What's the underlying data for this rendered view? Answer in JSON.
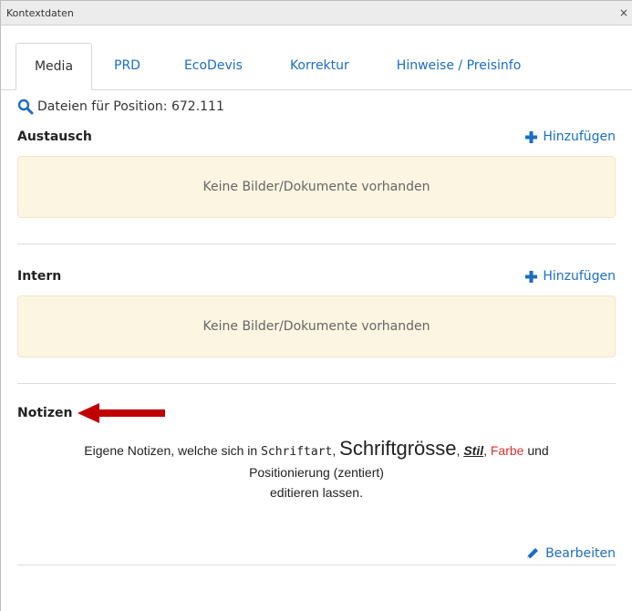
{
  "window": {
    "title": "Kontextdaten",
    "close_symbol": "×"
  },
  "tabs": [
    {
      "label": "Media"
    },
    {
      "label": "PRD"
    },
    {
      "label": "EcoDevis"
    },
    {
      "label": "Korrektur"
    },
    {
      "label": "Hinweise / Preisinfo"
    }
  ],
  "position": {
    "text": "Dateien für Position: 672.111"
  },
  "sections": {
    "austausch": {
      "title": "Austausch",
      "add_label": "Hinzufügen",
      "empty_text": "Keine Bilder/Dokumente vorhanden"
    },
    "intern": {
      "title": "Intern",
      "add_label": "Hinzufügen",
      "empty_text": "Keine Bilder/Dokumente vorhanden"
    }
  },
  "notes": {
    "title": "Notizen",
    "part1": "Eigene Notizen, welche sich in ",
    "schriftart": "Schriftart",
    "comma1": ", ",
    "schriftgroesse": "Schriftgrösse",
    "comma2": ", ",
    "stil": "Stil",
    "comma3": ", ",
    "farbe": "Farbe",
    "und": " und",
    "line2": "Positionierung (zentiert)",
    "line3": "editieren lassen.",
    "edit_label": "Bearbeiten"
  },
  "colors": {
    "link": "#1b6ec2",
    "empty_bg": "#fcf5e1",
    "arrow": "#c00000",
    "red_text": "#e03131"
  },
  "icons": [
    "search-icon",
    "plus-icon",
    "arrow-left-icon",
    "pencil-icon",
    "close-icon"
  ]
}
